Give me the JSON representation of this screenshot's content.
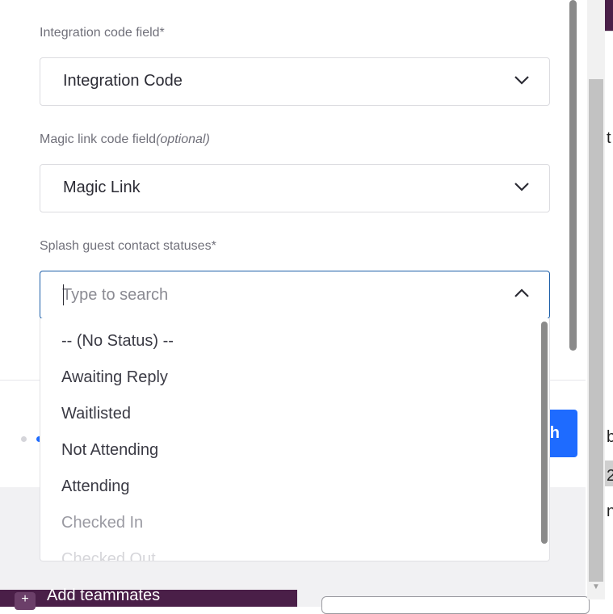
{
  "form": {
    "integration_label": "Integration code field*",
    "integration_value": "Integration Code",
    "magic_label_main": "Magic link code field",
    "magic_label_optional": "(optional)",
    "magic_value": "Magic Link",
    "statuses_label": "Splash guest contact statuses*",
    "statuses_search_placeholder": "Type to search"
  },
  "dropdown": {
    "options": [
      "-- (No Status) --",
      "Awaiting Reply",
      "Waitlisted",
      "Not Attending",
      "Attending",
      "Checked In",
      "Checked Out"
    ]
  },
  "footer": {
    "primary_button_visible_text": "h"
  },
  "background": {
    "sidebar_item": "Add teammates",
    "plus_glyph": "+",
    "snippet_1": "t",
    "snippet_2": "b",
    "snippet_3": "2",
    "snippet_4": "n"
  },
  "colors": {
    "accent": "#1e6bff",
    "focus_border": "#1c5ea8",
    "sidebar_purple": "#4a1f48"
  }
}
